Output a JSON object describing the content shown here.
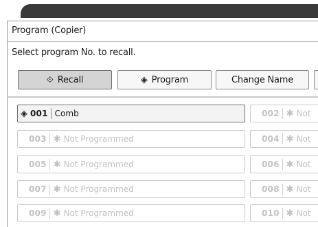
{
  "window": {
    "title": "Program (Copier)"
  },
  "instruction": "Select program No. to recall.",
  "toolbar": {
    "recall_icon": "⟐",
    "recall_label": "Recall",
    "program_icon": "◈",
    "program_label": "Program",
    "change_name_label": "Change Name"
  },
  "programs": [
    {
      "num": "001",
      "label": "Comb",
      "programmed": true
    },
    {
      "num": "002",
      "label": "Not",
      "programmed": false
    },
    {
      "num": "003",
      "label": "Not Programmed",
      "programmed": false
    },
    {
      "num": "004",
      "label": "Not",
      "programmed": false
    },
    {
      "num": "005",
      "label": "Not Programmed",
      "programmed": false
    },
    {
      "num": "006",
      "label": "Not",
      "programmed": false
    },
    {
      "num": "007",
      "label": "Not Programmed",
      "programmed": false
    },
    {
      "num": "008",
      "label": "Not",
      "programmed": false
    },
    {
      "num": "009",
      "label": "Not Programmed",
      "programmed": false
    },
    {
      "num": "010",
      "label": "Not",
      "programmed": false
    }
  ],
  "icons": {
    "programmed": "diamond-icon",
    "empty": "asterisk-icon"
  },
  "colors": {
    "accent": "#3a3a3a",
    "disabled_text": "#c2c2c2"
  }
}
